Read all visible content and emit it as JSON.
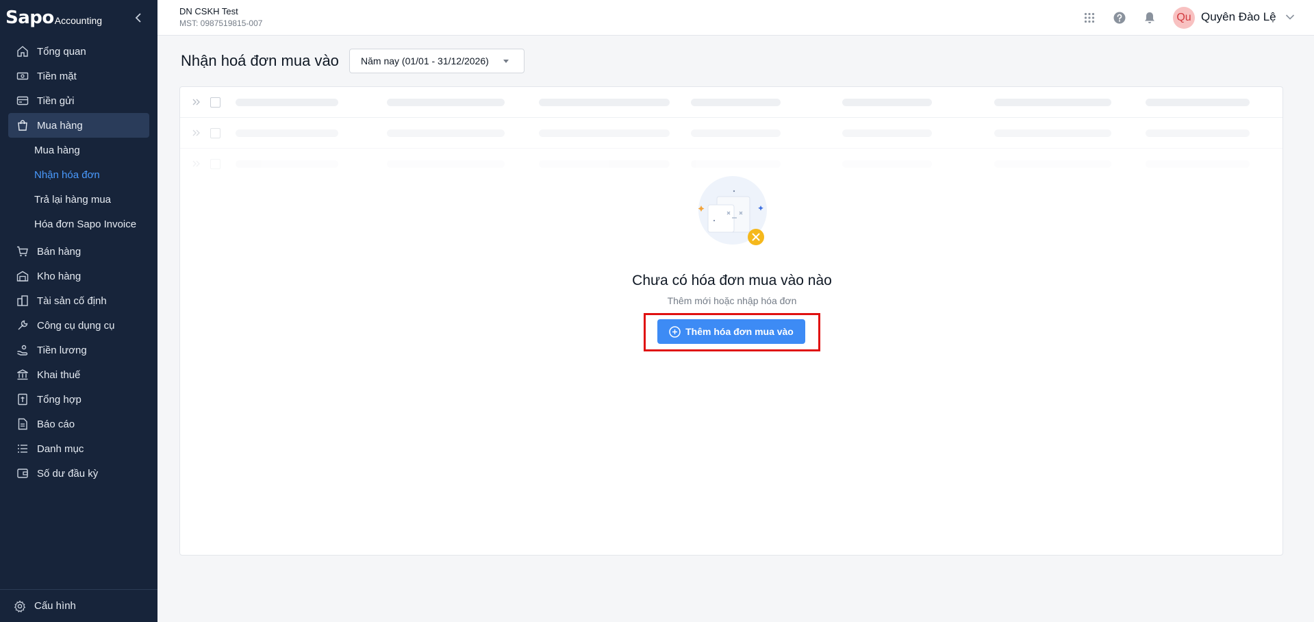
{
  "logo": {
    "main": "Sapo",
    "sub": "Accounting"
  },
  "sidebar": {
    "items_top": [
      {
        "label": "Tổng quan",
        "icon": "home-icon"
      },
      {
        "label": "Tiền mặt",
        "icon": "cash-icon"
      },
      {
        "label": "Tiền gửi",
        "icon": "card-icon"
      },
      {
        "label": "Mua hàng",
        "icon": "shopping-bag-icon"
      }
    ],
    "sub_items": [
      {
        "label": "Mua hàng"
      },
      {
        "label": "Nhận hóa đơn"
      },
      {
        "label": "Trả lại hàng mua"
      },
      {
        "label": "Hóa đơn Sapo Invoice"
      }
    ],
    "items_bottom": [
      {
        "label": "Bán hàng",
        "icon": "cart-icon"
      },
      {
        "label": "Kho hàng",
        "icon": "warehouse-icon"
      },
      {
        "label": "Tài sản cố định",
        "icon": "building-icon"
      },
      {
        "label": "Công cụ dụng cụ",
        "icon": "tool-icon"
      },
      {
        "label": "Tiền lương",
        "icon": "salary-icon"
      },
      {
        "label": "Khai thuế",
        "icon": "bank-icon"
      },
      {
        "label": "Tổng hợp",
        "icon": "ledger-icon"
      },
      {
        "label": "Báo cáo",
        "icon": "report-icon"
      },
      {
        "label": "Danh mục",
        "icon": "list-icon"
      },
      {
        "label": "Số dư đầu kỳ",
        "icon": "wallet-icon"
      }
    ],
    "settings": {
      "label": "Cấu hình",
      "icon": "gear-icon"
    }
  },
  "topbar": {
    "company_name": "DN CSKH Test",
    "company_mst": "MST: 0987519815-007",
    "avatar_initials": "Qu",
    "user_name": "Quyên Đào Lệ"
  },
  "page": {
    "title": "Nhận hoá đơn mua vào",
    "period": "Năm nay (01/01 - 31/12/2026)"
  },
  "empty_state": {
    "title": "Chưa có hóa đơn mua vào nào",
    "subtitle": "Thêm mới hoặc nhập hóa đơn",
    "button": "Thêm hóa đơn mua vào"
  },
  "colors": {
    "sidebar_bg": "#17243a",
    "active_bg": "#2a3c5a",
    "accent": "#3d8bf5",
    "link_active": "#4a9bff",
    "highlight": "#e01010"
  }
}
